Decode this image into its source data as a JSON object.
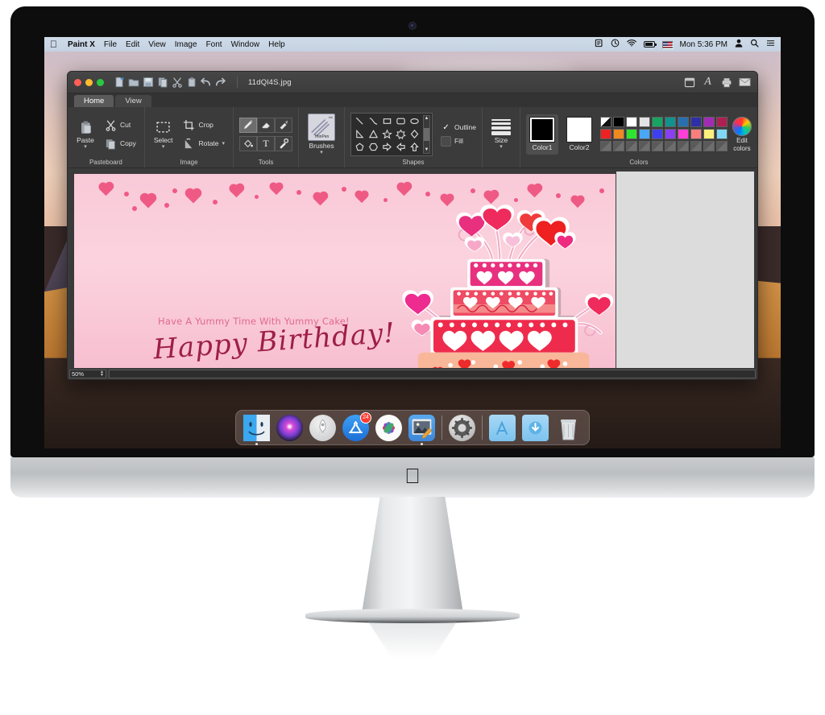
{
  "device": {
    "brand_logo": "apple-logo"
  },
  "menubar": {
    "apple": "",
    "app_name": "Paint X",
    "items": [
      "File",
      "Edit",
      "View",
      "Image",
      "Font",
      "Window",
      "Help"
    ],
    "status": {
      "screenshot_icon": "screenshot-icon",
      "timemachine_icon": "time-machine-icon",
      "wifi_icon": "wifi-icon",
      "battery_icon": "battery-icon",
      "input_flag": "us-flag-icon",
      "clock": "Mon 5:36 PM",
      "user_icon": "user-icon",
      "search_icon": "spotlight-search-icon",
      "controlcenter_icon": "notification-center-icon"
    }
  },
  "window": {
    "title": "11dQl4S.jpg",
    "traffic_lights": [
      "close",
      "minimize",
      "zoom"
    ],
    "toolbar_icons": [
      "new-file-icon",
      "open-folder-icon",
      "save-disk-icon",
      "duplicate-page-icon",
      "cut-scissors-icon",
      "paste-clipboard-icon",
      "undo-arrow-icon",
      "redo-arrow-icon"
    ],
    "right_icons": [
      "panel-icon",
      "font-icon",
      "print-icon",
      "mail-icon"
    ],
    "tabs": [
      {
        "label": "Home",
        "active": true
      },
      {
        "label": "View",
        "active": false
      }
    ]
  },
  "ribbon": {
    "groups": [
      {
        "label": "Pasteboard",
        "buttons": [
          {
            "label": "Paste",
            "icon": "paste-icon",
            "has_menu": true
          },
          {
            "label": "Cut",
            "icon": "scissors-icon",
            "has_menu": false
          },
          {
            "label": "Copy",
            "icon": "copy-icon",
            "has_menu": false
          }
        ]
      },
      {
        "label": "Image",
        "buttons": [
          {
            "label": "Select",
            "icon": "selection-marquee-icon",
            "has_menu": true
          },
          {
            "label": "Crop",
            "icon": "crop-icon",
            "has_menu": false
          },
          {
            "label": "Rotate",
            "icon": "rotate-icon",
            "has_menu": true
          }
        ]
      },
      {
        "label": "Tools",
        "tools": [
          {
            "name": "pencil-icon",
            "selected": true
          },
          {
            "name": "eraser-icon",
            "selected": false
          },
          {
            "name": "spray-can-icon",
            "selected": false
          },
          {
            "name": "paint-bucket-icon",
            "selected": false
          },
          {
            "name": "text-tool-icon",
            "selected": false
          },
          {
            "name": "eyedropper-icon",
            "selected": false
          }
        ]
      },
      {
        "label": "Brushes",
        "brush": {
          "label": "Brushes",
          "thumb_name": "ThinPen",
          "thumb_tag": "Ink",
          "has_menu": true
        }
      },
      {
        "label": "Shapes",
        "shapes": [
          "line-shape",
          "curve-shape",
          "rectangle-shape",
          "rounded-rectangle-shape",
          "ellipse-shape",
          "right-triangle-shape",
          "triangle-shape",
          "five-point-star-shape",
          "six-point-star-shape",
          "diamond-shape",
          "pentagon-shape",
          "hexagon-shape",
          "right-arrow-shape",
          "left-arrow-shape",
          "up-arrow-shape"
        ],
        "options": [
          {
            "label": "Outline",
            "checked": true
          },
          {
            "label": "Fill",
            "checked": false
          }
        ]
      },
      {
        "label": "Size",
        "size": {
          "label": "Size",
          "has_menu": true,
          "icon": "line-thickness-icon"
        }
      },
      {
        "label": "Colors",
        "color1": {
          "label": "Color1",
          "value": "#000000",
          "selected": true
        },
        "color2": {
          "label": "Color2",
          "value": "#ffffff",
          "selected": false
        },
        "palette_row1": [
          "transparent",
          "#000000",
          "#ffffff",
          "#e3e3e3",
          "#17a463",
          "#12918f",
          "#2a6fad",
          "#2d2fa8",
          "#a22bb5",
          "#ae1f52"
        ],
        "palette_row2": [
          "#ee2222",
          "#f08a20",
          "#2ee52e",
          "#4aa7f5",
          "#3f3ff0",
          "#8a3ff0",
          "#ff3fd8",
          "#fb7e7e",
          "#fbf07c",
          "#7fd9f5"
        ],
        "palette_row3_disabled_count": 10,
        "edit_colors": {
          "label_line1": "Edit",
          "label_line2": "colors",
          "icon": "color-wheel-icon"
        }
      }
    ]
  },
  "canvas": {
    "card_text_line1": "Have A Yummy Time With Yummy Cake!",
    "card_text_line2": "Happy Birthday!",
    "artwork": "birthday-cake-with-heart-balloons",
    "background_colors": [
      "#f9c9d8",
      "#fbd3de",
      "#f7bed0"
    ],
    "heart_color": "#ef5a85",
    "cake_colors": {
      "top_tier": "#e8307f",
      "middle_tier": "#ef4b64",
      "bottom_tier": "#ee2b4c",
      "base_tier": "#f9b79a"
    }
  },
  "statusbar": {
    "zoom": "50%"
  },
  "dock": {
    "items": [
      {
        "name": "finder",
        "running": true
      },
      {
        "name": "siri",
        "running": false
      },
      {
        "name": "launchpad",
        "running": false
      },
      {
        "name": "app-store",
        "running": false,
        "badge": "24"
      },
      {
        "name": "photos",
        "running": false
      },
      {
        "name": "paint-x",
        "running": true,
        "active": true
      },
      {
        "name": "system-preferences",
        "running": false
      },
      {
        "name": "applications-folder",
        "running": false
      },
      {
        "name": "downloads-folder",
        "running": false
      },
      {
        "name": "trash",
        "running": false
      }
    ]
  }
}
